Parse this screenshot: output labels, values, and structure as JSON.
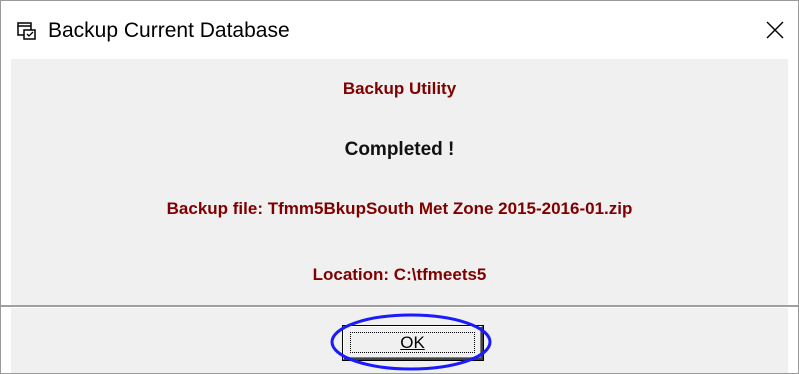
{
  "window": {
    "title": "Backup Current Database"
  },
  "icons": {
    "app": "database-backup-icon",
    "close": "close-icon"
  },
  "content": {
    "heading": "Backup Utility",
    "status": "Completed !",
    "file_line": "Backup file: Tfmm5BkupSouth Met Zone 2015-2016-01.zip",
    "location_line": "Location: C:\\tfmeets5"
  },
  "buttons": {
    "ok_label": "OK"
  },
  "colors": {
    "heading_text": "#800000",
    "status_text": "#111111",
    "highlight_ellipse": "#1a1aff",
    "title_bar": "#ffffff",
    "dialog_body": "#f0f0f0"
  }
}
